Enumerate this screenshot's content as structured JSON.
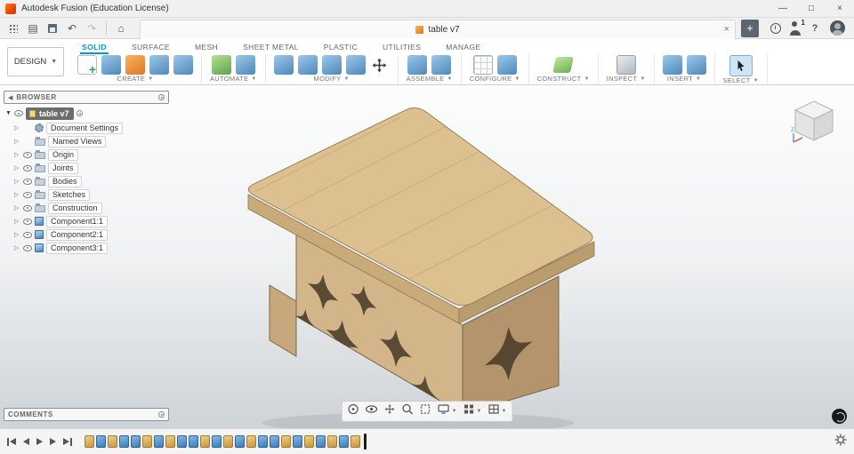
{
  "titlebar": {
    "title": "Autodesk Fusion (Education License)",
    "controls": [
      {
        "name": "minimize",
        "glyph": "—"
      },
      {
        "name": "maximize",
        "glyph": "□"
      },
      {
        "name": "close",
        "glyph": "×"
      }
    ]
  },
  "quickbar": {
    "document_tab": {
      "label": "table v7",
      "close_glyph": "×"
    },
    "new_tab_glyph": "+",
    "user_badge": "1",
    "help_glyph": "?",
    "undo_glyph": "↶",
    "redo_glyph": "↷",
    "home_glyph": "⌂",
    "file_glyph": "▤"
  },
  "ribbon": {
    "design_label": "DESIGN",
    "active_tab": "SOLID",
    "tabs": [
      "SOLID",
      "SURFACE",
      "MESH",
      "SHEET METAL",
      "PLASTIC",
      "UTILITIES",
      "MANAGE"
    ],
    "groups": [
      {
        "label": "CREATE",
        "icons": [
          "create-sketch",
          "solid-box",
          "form",
          "loft",
          "revolve"
        ]
      },
      {
        "label": "AUTOMATE",
        "icons": [
          "web-automate",
          "scripts"
        ]
      },
      {
        "label": "MODIFY",
        "icons": [
          "press-pull",
          "fillet",
          "shell",
          "combine",
          "move-arrows"
        ]
      },
      {
        "label": "ASSEMBLE",
        "icons": [
          "new-component",
          "joint"
        ]
      },
      {
        "label": "CONFIGURE",
        "icons": [
          "configuration",
          "config-insert"
        ]
      },
      {
        "label": "CONSTRUCT",
        "icons": [
          "construct-plane"
        ]
      },
      {
        "label": "INSPECT",
        "icons": [
          "measure"
        ]
      },
      {
        "label": "INSERT",
        "icons": [
          "insert-mcmaster",
          "decal"
        ]
      },
      {
        "label": "SELECT",
        "icons": [
          "select-cursor"
        ]
      }
    ]
  },
  "browser": {
    "header": "BROWSER",
    "root": {
      "label": "table v7"
    },
    "items": [
      {
        "label": "Document Settings",
        "icon": "gear",
        "eye": false
      },
      {
        "label": "Named Views",
        "icon": "folder",
        "eye": false
      },
      {
        "label": "Origin",
        "icon": "folder",
        "eye": true
      },
      {
        "label": "Joints",
        "icon": "folder",
        "eye": true
      },
      {
        "label": "Bodies",
        "icon": "folder",
        "eye": true
      },
      {
        "label": "Sketches",
        "icon": "folder",
        "eye": true
      },
      {
        "label": "Construction",
        "icon": "folder",
        "eye": true
      },
      {
        "label": "Component1:1",
        "icon": "component",
        "eye": true
      },
      {
        "label": "Component2:1",
        "icon": "component",
        "eye": true
      },
      {
        "label": "Component3:1",
        "icon": "component",
        "eye": true
      }
    ]
  },
  "comments": {
    "label": "COMMENTS"
  },
  "navbar": {
    "icons": [
      {
        "name": "orbit",
        "caret": false
      },
      {
        "name": "look-at",
        "caret": false
      },
      {
        "name": "pan",
        "caret": false
      },
      {
        "name": "zoom",
        "caret": false
      },
      {
        "name": "fit",
        "caret": false
      },
      {
        "name": "display-settings",
        "caret": true
      },
      {
        "name": "grid-layout",
        "caret": true
      },
      {
        "name": "viewports",
        "caret": true
      }
    ]
  },
  "timeline": {
    "controls": [
      "go-to-start",
      "step-back",
      "play",
      "step-forward",
      "go-to-end"
    ],
    "features": [
      "sketch",
      "extrude",
      "sketch",
      "extrude",
      "extrude",
      "sketch",
      "extrude",
      "sketch",
      "extrude",
      "extrude",
      "sketch",
      "extrude",
      "sketch",
      "extrude",
      "sketch",
      "extrude",
      "extrude",
      "sketch",
      "extrude",
      "sketch",
      "extrude",
      "sketch",
      "extrude",
      "sketch"
    ]
  },
  "colors": {
    "accent_blue": "#0696d7",
    "wood_top": "#dcc08f",
    "wood_edge_front": "#c9ab79",
    "wood_edge_right": "#b99d6e",
    "wood_face_front": "#d2b68a",
    "wood_face_right": "#b3946c",
    "cutout_dark": "#4a3b28"
  }
}
